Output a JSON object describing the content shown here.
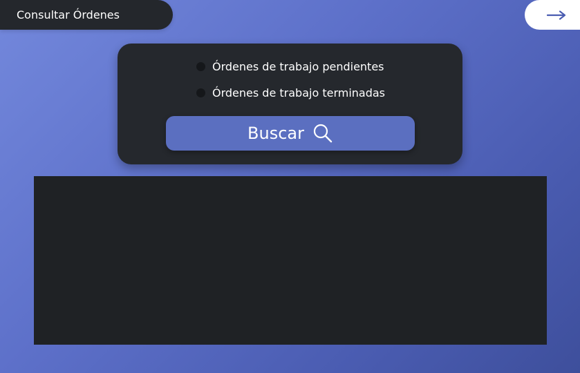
{
  "header": {
    "title": "Consultar Órdenes",
    "next_icon": "arrow-right-icon"
  },
  "filters": {
    "options": [
      {
        "label": "Órdenes de trabajo pendientes",
        "selected": false
      },
      {
        "label": "Órdenes de trabajo terminadas",
        "selected": false
      }
    ],
    "search_label": "Buscar",
    "search_icon": "search-icon"
  },
  "colors": {
    "accent": "#5b6fc0",
    "card": "#25282d",
    "panel": "#1f2225",
    "background_start": "#7388dc",
    "background_end": "#3e4f9c"
  }
}
